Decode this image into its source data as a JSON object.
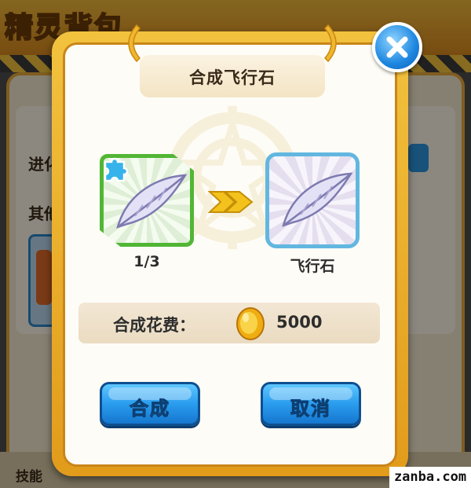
{
  "background": {
    "title": "精灵背包",
    "text_1": "进化",
    "text_2": "其他",
    "text_3": "技能"
  },
  "dialog": {
    "title": "合成飞行石",
    "source_item": {
      "label": "1/3",
      "icon": "feather-fragment-icon"
    },
    "target_item": {
      "label": "飞行石",
      "icon": "feather-icon"
    },
    "cost": {
      "label": "合成花费：",
      "value": "5000",
      "currency_icon": "gold-coin-icon"
    },
    "buttons": {
      "combine": "合成",
      "cancel": "取消"
    },
    "close_icon": "close-icon"
  },
  "watermark": "zanba.com",
  "colors": {
    "frame": "#e9a92a",
    "button_blue": "#2a9cee",
    "source_border": "#51b634",
    "target_border": "#62b7e0"
  }
}
